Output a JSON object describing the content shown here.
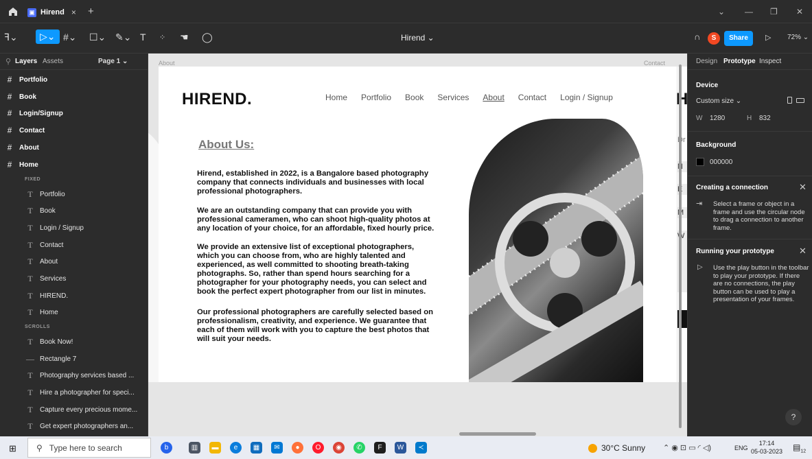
{
  "tabbar": {
    "tab_title": "Hirend",
    "tab_close": "×",
    "new_tab": "+",
    "minimize": "—",
    "restore": "❐",
    "close": "✕",
    "chevron": "⌄"
  },
  "toolbar": {
    "file_title": "Hirend ⌄",
    "share_label": "Share",
    "avatar_initial": "S",
    "zoom": "72% ⌄",
    "play": "▷"
  },
  "left_panel": {
    "tab_layers": "Layers",
    "tab_assets": "Assets",
    "page": "Page 1 ⌄",
    "frames": [
      "Portfolio",
      "Book",
      "Login/Signup",
      "Contact",
      "About",
      "Home"
    ],
    "section_fixed": "FIXED",
    "fixed_items": [
      "Portfolio",
      "Book",
      "Login / Signup",
      "Contact",
      "About",
      "Services",
      "HIREND.",
      "Home"
    ],
    "section_scrolls": "SCROLLS",
    "scroll_items": [
      {
        "icon": "T",
        "label": "Book Now!"
      },
      {
        "icon": "—",
        "label": "Rectangle 7"
      },
      {
        "icon": "T",
        "label": "Photography services based ..."
      },
      {
        "icon": "T",
        "label": "Hire a photographer for speci..."
      },
      {
        "icon": "T",
        "label": "Capture every precious mome..."
      },
      {
        "icon": "T",
        "label": "Get expert photographers an..."
      }
    ]
  },
  "canvas": {
    "frame_label_about": "About",
    "frame_label_contact": "Contact",
    "logo": "HIREND.",
    "nav": [
      "Home",
      "Portfolio",
      "Book",
      "Services",
      "About",
      "Contact",
      "Login / Signup"
    ],
    "about_title": "About Us:",
    "paragraphs": [
      "Hirend, established in 2022, is a Bangalore based photography company that connects individuals and businesses with local professional photographers.",
      "We are an outstanding company that can provide you with professional cameramen, who can shoot high-quality photos at any location of your choice, for an affordable, fixed hourly price.",
      "We provide an extensive list of exceptional photographers, which you can choose from, who are highly talented and experienced, as well committed to shooting breath-taking photographs. So, rather than spend hours searching for a photographer for your photography needs, you can select and book the perfect expert photographer from our list in minutes.",
      "Our professional photographers are carefully selected based on professionalism, creativity, and experience. We guarantee that each of them will work with you to capture the best photos that will suit your needs."
    ],
    "next_frame_logo": "HI",
    "next_frame_letters": [
      "Dr",
      "N",
      "E",
      "M",
      "W"
    ]
  },
  "right_panel": {
    "tab_design": "Design",
    "tab_prototype": "Prototype",
    "tab_inspect": "Inspect",
    "device_label": "Device",
    "device_value": "Custom size ⌄",
    "w_label": "W",
    "w_value": "1280",
    "h_label": "H",
    "h_value": "832",
    "background_label": "Background",
    "background_value": "000000",
    "creating_title": "Creating a connection",
    "creating_text": "Select a frame or object in a frame and use the circular node to drag a connection to another frame.",
    "running_title": "Running your prototype",
    "running_text": "Use the play button in the toolbar to play your prototype. If there are no connections, the play button can be used to play a presentation of your frames.",
    "help": "?"
  },
  "taskbar": {
    "search_placeholder": "Type here to search",
    "weather": "30°C Sunny",
    "lang": "ENG",
    "time": "17:14",
    "date": "05-03-2023",
    "notif_count": "12"
  },
  "colors": {
    "accent": "#0d99ff",
    "panel_bg": "#2c2c2c",
    "canvas_bg": "#e5e5e5"
  }
}
